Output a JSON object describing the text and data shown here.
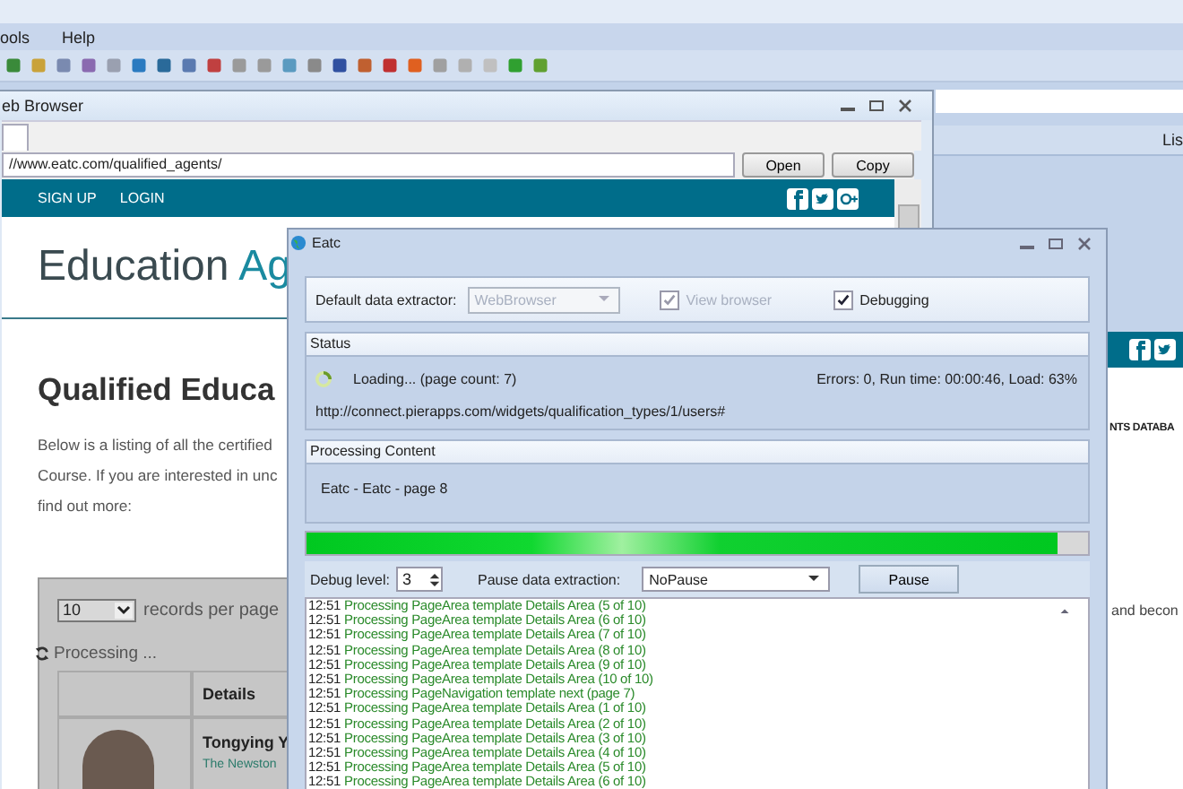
{
  "app": {
    "menu": [
      "ools",
      "Help"
    ],
    "right_header": "Lis",
    "right_heading": "NTS DATABA",
    "right_text": "and becon"
  },
  "browser": {
    "title": "eb Browser",
    "url": "//www.eatc.com/qualified_agents/",
    "buttons": [
      "Open",
      "Copy"
    ],
    "nav": [
      "SIGN UP",
      "LOGIN"
    ],
    "heading": "Education",
    "heading_accent": "Ag",
    "title2": "Qualified Educa",
    "paragraph": [
      "Below is a listing of all the certified",
      "Course. If you are interested in unc",
      "find out more:"
    ],
    "page_size": "10",
    "page_size_label": "records per page",
    "processing": "Processing ...",
    "table_header": "Details",
    "row_name": "Tongying Y",
    "row_company": "The Newston"
  },
  "extractor": {
    "title": "Eatc",
    "default_label": "Default data extractor:",
    "default_value": "WebBrowser",
    "default_disabled": true,
    "options": [
      {
        "label": "View browser",
        "checked": true,
        "disabled": true
      },
      {
        "label": "Debugging",
        "checked": true,
        "disabled": false
      }
    ],
    "status_header": "Status",
    "loading": "Loading... (page count: 7)",
    "stats": "Errors: 0, Run time: 00:00:46, Load: 63%",
    "url": "http://connect.pierapps.com/widgets/qualification_types/1/users#",
    "processing_header": "Processing Content",
    "processing_text": "Eatc - Eatc - page 8",
    "progress": {
      "level": 0.96
    },
    "debug_label": "Debug level:",
    "debug_value": "3",
    "pause_label": "Pause data extraction:",
    "pause_value": "NoPause",
    "pause_button": "Pause",
    "log": [
      {
        "time": "12:51",
        "text": "Processing PageArea template Details Area (5 of 10)"
      },
      {
        "time": "12:51",
        "text": "Processing PageArea template Details Area (6 of 10)"
      },
      {
        "time": "12:51",
        "text": "Processing PageArea template Details Area (7 of 10)"
      },
      {
        "time": "12:51",
        "text": "Processing PageArea template Details Area (8 of 10)"
      },
      {
        "time": "12:51",
        "text": "Processing PageArea template Details Area (9 of 10)"
      },
      {
        "time": "12:51",
        "text": "Processing PageArea template Details Area (10 of 10)"
      },
      {
        "time": "12:51",
        "text": "Processing PageNavigation template next (page 7)"
      },
      {
        "time": "12:51",
        "text": "Processing PageArea template Details Area (1 of 10)"
      },
      {
        "time": "12:51",
        "text": "Processing PageArea template Details Area (2 of 10)"
      },
      {
        "time": "12:51",
        "text": "Processing PageArea template Details Area (3 of 10)"
      },
      {
        "time": "12:51",
        "text": "Processing PageArea template Details Area (4 of 10)"
      },
      {
        "time": "12:51",
        "text": "Processing PageArea template Details Area (5 of 10)"
      },
      {
        "time": "12:51",
        "text": "Processing PageArea template Details Area (6 of 10)"
      }
    ]
  }
}
